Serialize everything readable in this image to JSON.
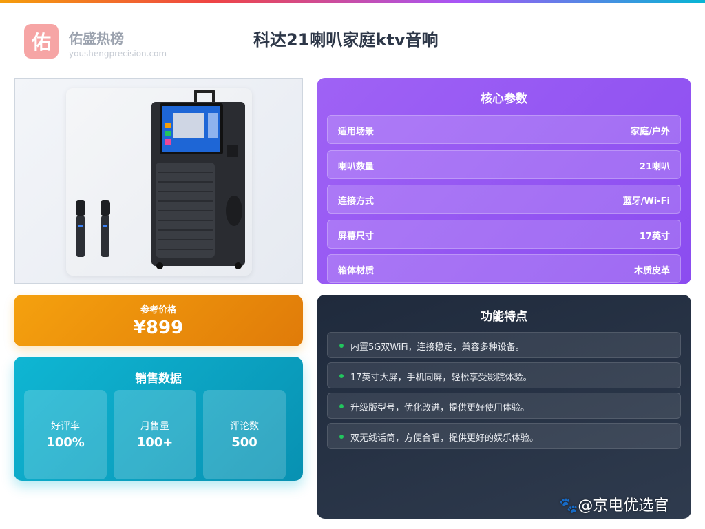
{
  "brand": {
    "logo_char": "佑",
    "name": "佑盛热榜",
    "domain": "youshengprecision.com"
  },
  "title": "科达21喇叭家庭ktv音响",
  "price": {
    "label": "参考价格",
    "value": "¥899"
  },
  "sales": {
    "title": "销售数据",
    "stats": [
      {
        "label": "好评率",
        "value": "100%"
      },
      {
        "label": "月售量",
        "value": "100+"
      },
      {
        "label": "评论数",
        "value": "500"
      }
    ]
  },
  "params": {
    "title": "核心参数",
    "rows": [
      {
        "key": "适用场景",
        "value": "家庭/户外"
      },
      {
        "key": "喇叭数量",
        "value": "21喇叭"
      },
      {
        "key": "连接方式",
        "value": "蓝牙/Wi-Fi"
      },
      {
        "key": "屏幕尺寸",
        "value": "17英寸"
      },
      {
        "key": "箱体材质",
        "value": "木质皮革"
      }
    ]
  },
  "features": {
    "title": "功能特点",
    "items": [
      "内置5G双WiFi，连接稳定，兼容多种设备。",
      "17英寸大屏，手机同屏，轻松享受影院体验。",
      "升级版型号，优化改进，提供更好使用体验。",
      "双无线话筒，方便合唱，提供更好的娱乐体验。"
    ]
  },
  "watermark": "🐾@京电优选官",
  "colors": {
    "price": "#f5a10e",
    "sales": "#0fb6d3",
    "params": "#9f62f5",
    "features": "#1f2a3c",
    "feature_dot": "#22c55e"
  }
}
